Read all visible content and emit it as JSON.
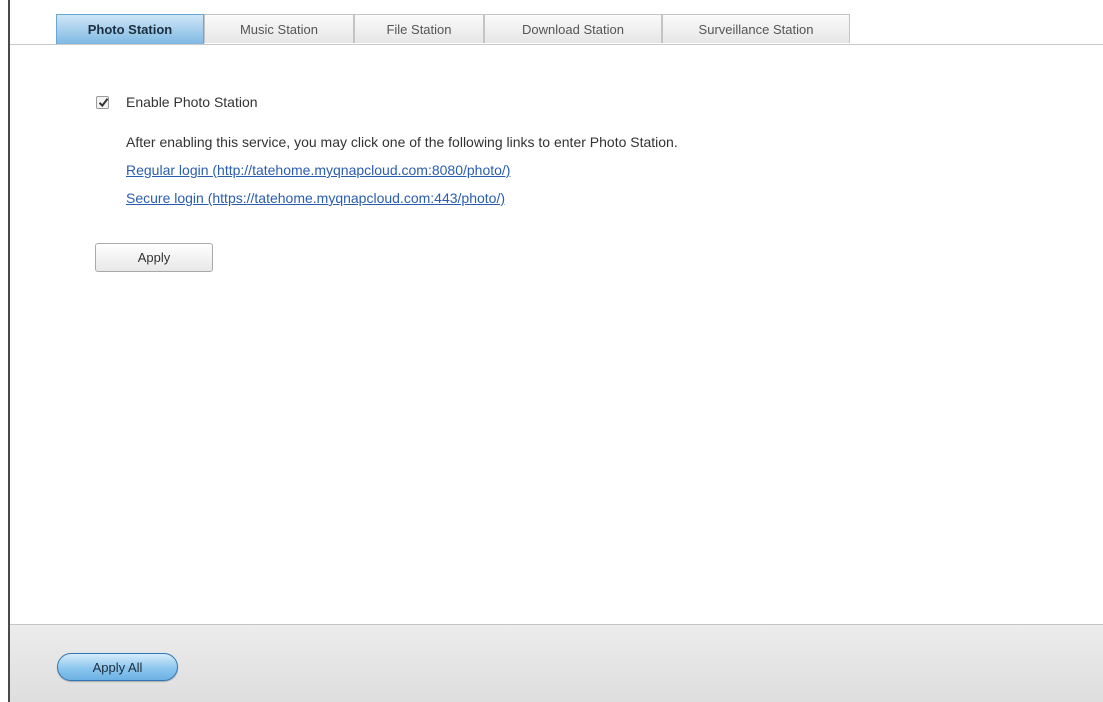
{
  "tabs": [
    {
      "label": "Photo Station",
      "active": true
    },
    {
      "label": "Music Station",
      "active": false
    },
    {
      "label": "File Station",
      "active": false
    },
    {
      "label": "Download Station",
      "active": false
    },
    {
      "label": "Surveillance Station",
      "active": false
    }
  ],
  "photo_station": {
    "enable_checked": true,
    "enable_label": "Enable Photo Station",
    "description": "After enabling this service, you may click one of the following links to enter Photo Station.",
    "regular_login_link": "Regular login (http://tatehome.myqnapcloud.com:8080/photo/)",
    "secure_login_link": "Secure login (https://tatehome.myqnapcloud.com:443/photo/)",
    "apply_label": "Apply"
  },
  "footer": {
    "apply_all_label": "Apply All"
  },
  "colors": {
    "active_tab": "#7fb9e3",
    "link": "#2a5db0",
    "footer_bg": "#e4e4e4"
  }
}
